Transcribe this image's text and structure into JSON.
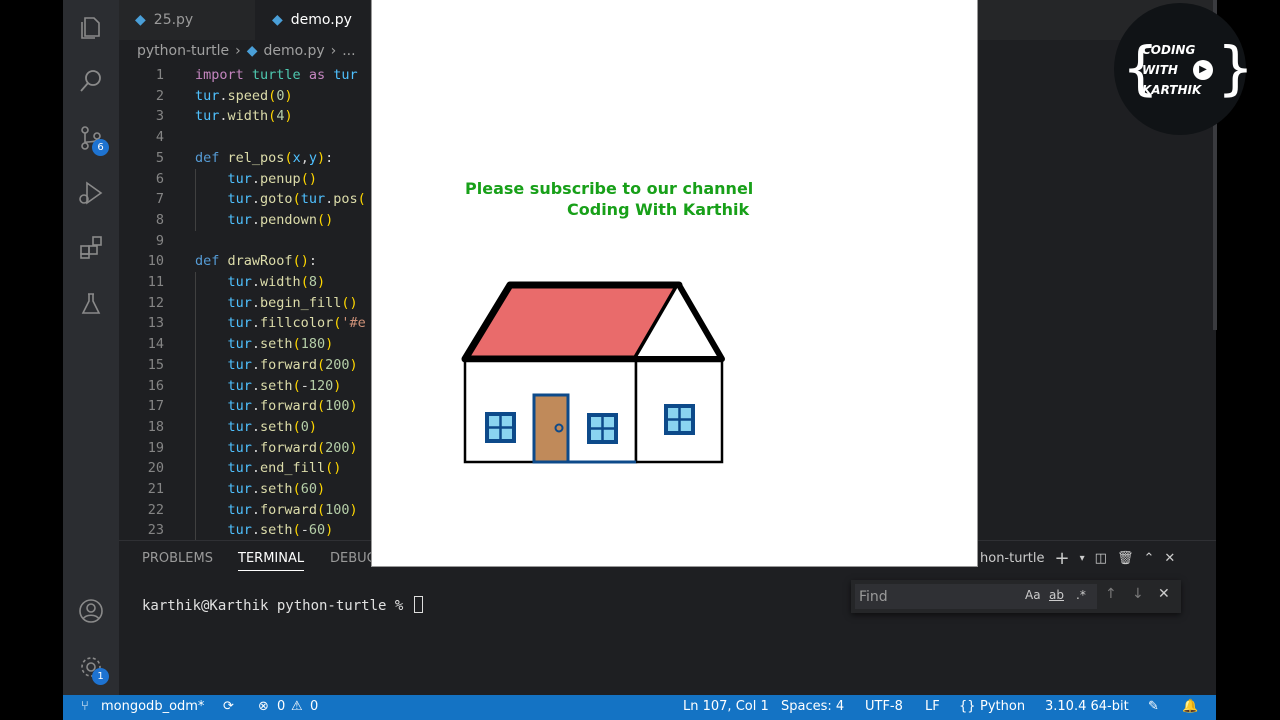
{
  "tabs": [
    {
      "label": "25.py"
    },
    {
      "label": "demo.py"
    }
  ],
  "breadcrumb": {
    "folder": "python-turtle",
    "file": "demo.py",
    "more": "..."
  },
  "code_lines": [
    {
      "n": "1",
      "text": "import turtle as tur"
    },
    {
      "n": "2",
      "text": "tur.speed(0)"
    },
    {
      "n": "3",
      "text": "tur.width(4)"
    },
    {
      "n": "4",
      "text": ""
    },
    {
      "n": "5",
      "text": "def rel_pos(x,y):"
    },
    {
      "n": "6",
      "text": "    tur.penup()"
    },
    {
      "n": "7",
      "text": "    tur.goto(tur.pos("
    },
    {
      "n": "8",
      "text": "    tur.pendown()"
    },
    {
      "n": "9",
      "text": ""
    },
    {
      "n": "10",
      "text": "def drawRoof():"
    },
    {
      "n": "11",
      "text": "    tur.width(8)"
    },
    {
      "n": "12",
      "text": "    tur.begin_fill()"
    },
    {
      "n": "13",
      "text": "    tur.fillcolor('#e"
    },
    {
      "n": "14",
      "text": "    tur.seth(180)"
    },
    {
      "n": "15",
      "text": "    tur.forward(200)"
    },
    {
      "n": "16",
      "text": "    tur.seth(-120)"
    },
    {
      "n": "17",
      "text": "    tur.forward(100)"
    },
    {
      "n": "18",
      "text": "    tur.seth(0)"
    },
    {
      "n": "19",
      "text": "    tur.forward(200)"
    },
    {
      "n": "20",
      "text": "    tur.end_fill()"
    },
    {
      "n": "21",
      "text": "    tur.seth(60)"
    },
    {
      "n": "22",
      "text": "    tur.forward(100)"
    },
    {
      "n": "23",
      "text": "    tur.seth(-60)"
    }
  ],
  "panel": {
    "tabs": [
      "PROBLEMS",
      "TERMINAL",
      "DEBUG"
    ],
    "terminal_prompt": "karthik@Karthik python-turtle % ",
    "terminal_title": "hon-turtle"
  },
  "find": {
    "placeholder": "Find",
    "match_case": "Aa",
    "whole_word": "ab",
    "regex": ".*"
  },
  "activity": {
    "scm_badge": "6",
    "settings_badge": "1"
  },
  "statusbar": {
    "branch": "mongodb_odm*",
    "errors": "0",
    "warnings": "0",
    "position": "Ln 107, Col 1",
    "spaces": "Spaces: 4",
    "encoding": "UTF-8",
    "eol": "LF",
    "language": "Python",
    "interpreter": "3.10.4 64-bit"
  },
  "turtle": {
    "line1": "Please subscribe to our channel",
    "line2": "Coding With Karthik",
    "text_color": "#18a019",
    "roof_color": "#e96b6b",
    "door_color": "#c08a5a",
    "window_color": "#8ad4f0",
    "frame_color": "#0d4a8a"
  },
  "logo": {
    "line1": "CODING",
    "line2": "WITH",
    "line3": "KARTHIK"
  }
}
